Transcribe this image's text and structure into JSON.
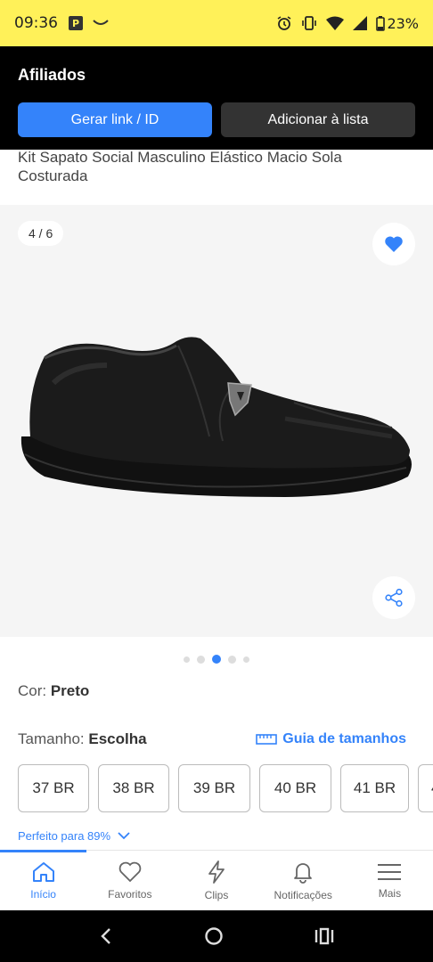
{
  "status": {
    "time": "09:36",
    "battery": "23%"
  },
  "header": {
    "title": "Afiliados",
    "generate_label": "Gerar link / ID",
    "add_list_label": "Adicionar à lista"
  },
  "product": {
    "title": "Kit Sapato Social Masculino Elástico Macio Sola Costurada",
    "image_counter": "4 / 6",
    "gallery_total": 6,
    "gallery_current": 4
  },
  "color": {
    "label": "Cor: ",
    "value": "Preto"
  },
  "size": {
    "label": "Tamanho: ",
    "value": "Escolha",
    "guide_label": "Guia de tamanhos",
    "options": [
      "37 BR",
      "38 BR",
      "39 BR",
      "40 BR",
      "41 BR",
      "4"
    ]
  },
  "fit": {
    "label": "Perfeito para 89%"
  },
  "tabs": [
    {
      "label": "Início",
      "icon": "home-icon"
    },
    {
      "label": "Favoritos",
      "icon": "heart-icon"
    },
    {
      "label": "Clips",
      "icon": "lightning-icon"
    },
    {
      "label": "Notificações",
      "icon": "bell-icon"
    },
    {
      "label": "Mais",
      "icon": "menu-icon"
    }
  ],
  "colors": {
    "accent": "#3483fa",
    "status_bar": "#fff159",
    "header_bg": "#000000"
  }
}
